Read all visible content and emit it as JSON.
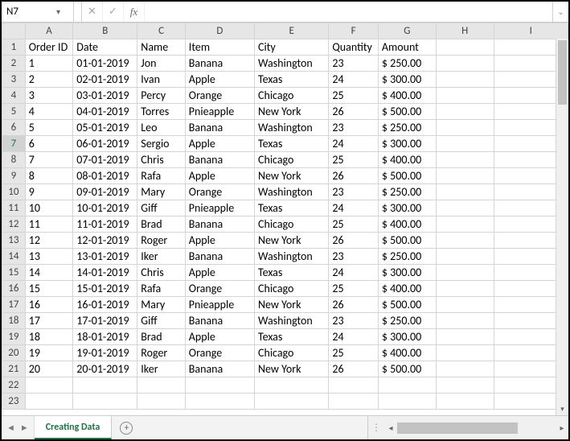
{
  "formula_bar": {
    "name_box": "N7",
    "cancel": "✕",
    "confirm": "✓",
    "fx": "fx",
    "formula": "",
    "expand": "⌄"
  },
  "columns": [
    "A",
    "B",
    "C",
    "D",
    "E",
    "F",
    "G",
    "H",
    "I"
  ],
  "headers": [
    "Order ID",
    "Date",
    "Name",
    "Item",
    "City",
    "Quantity",
    "Amount"
  ],
  "rows": [
    {
      "n": 1,
      "id": "1",
      "date": "01-01-2019",
      "name": "Jon",
      "item": "Banana",
      "city": "Washington",
      "qty": "23",
      "amt": "$ 250.00"
    },
    {
      "n": 2,
      "id": "2",
      "date": "02-01-2019",
      "name": "Ivan",
      "item": "Apple",
      "city": "Texas",
      "qty": "24",
      "amt": "$ 300.00"
    },
    {
      "n": 3,
      "id": "3",
      "date": "03-01-2019",
      "name": "Percy",
      "item": "Orange",
      "city": "Chicago",
      "qty": "25",
      "amt": "$ 400.00"
    },
    {
      "n": 4,
      "id": "4",
      "date": "04-01-2019",
      "name": "Torres",
      "item": "Pnieapple",
      "city": "New York",
      "qty": "26",
      "amt": "$ 500.00"
    },
    {
      "n": 5,
      "id": "5",
      "date": "05-01-2019",
      "name": "Leo",
      "item": "Banana",
      "city": "Washington",
      "qty": "23",
      "amt": "$ 250.00"
    },
    {
      "n": 6,
      "id": "6",
      "date": "06-01-2019",
      "name": "Sergio",
      "item": "Apple",
      "city": "Texas",
      "qty": "24",
      "amt": "$ 300.00"
    },
    {
      "n": 7,
      "id": "7",
      "date": "07-01-2019",
      "name": "Chris",
      "item": "Banana",
      "city": "Chicago",
      "qty": "25",
      "amt": "$ 400.00"
    },
    {
      "n": 8,
      "id": "8",
      "date": "08-01-2019",
      "name": "Rafa",
      "item": "Apple",
      "city": "New York",
      "qty": "26",
      "amt": "$ 500.00"
    },
    {
      "n": 9,
      "id": "9",
      "date": "09-01-2019",
      "name": "Mary",
      "item": "Orange",
      "city": "Washington",
      "qty": "23",
      "amt": "$ 250.00"
    },
    {
      "n": 10,
      "id": "10",
      "date": "10-01-2019",
      "name": "Giff",
      "item": "Pnieapple",
      "city": "Texas",
      "qty": "24",
      "amt": "$ 300.00"
    },
    {
      "n": 11,
      "id": "11",
      "date": "11-01-2019",
      "name": "Brad",
      "item": "Banana",
      "city": "Chicago",
      "qty": "25",
      "amt": "$ 400.00"
    },
    {
      "n": 12,
      "id": "12",
      "date": "12-01-2019",
      "name": "Roger",
      "item": "Apple",
      "city": "New York",
      "qty": "26",
      "amt": "$ 500.00"
    },
    {
      "n": 13,
      "id": "13",
      "date": "13-01-2019",
      "name": "Iker",
      "item": "Banana",
      "city": "Washington",
      "qty": "23",
      "amt": "$ 250.00"
    },
    {
      "n": 14,
      "id": "14",
      "date": "14-01-2019",
      "name": "Chris",
      "item": "Apple",
      "city": "Texas",
      "qty": "24",
      "amt": "$ 300.00"
    },
    {
      "n": 15,
      "id": "15",
      "date": "15-01-2019",
      "name": "Rafa",
      "item": "Orange",
      "city": "Chicago",
      "qty": "25",
      "amt": "$ 400.00"
    },
    {
      "n": 16,
      "id": "16",
      "date": "16-01-2019",
      "name": "Mary",
      "item": "Pnieapple",
      "city": "New York",
      "qty": "26",
      "amt": "$ 500.00"
    },
    {
      "n": 17,
      "id": "17",
      "date": "17-01-2019",
      "name": "Giff",
      "item": "Banana",
      "city": "Washington",
      "qty": "23",
      "amt": "$ 250.00"
    },
    {
      "n": 18,
      "id": "18",
      "date": "18-01-2019",
      "name": "Brad",
      "item": "Apple",
      "city": "Texas",
      "qty": "24",
      "amt": "$ 300.00"
    },
    {
      "n": 19,
      "id": "19",
      "date": "19-01-2019",
      "name": "Roger",
      "item": "Orange",
      "city": "Chicago",
      "qty": "25",
      "amt": "$ 400.00"
    },
    {
      "n": 20,
      "id": "20",
      "date": "20-01-2019",
      "name": "Iker",
      "item": "Banana",
      "city": "New York",
      "qty": "26",
      "amt": "$ 500.00"
    }
  ],
  "extra_rows": [
    22,
    23
  ],
  "selected_row": 7,
  "sheet_tabs": {
    "active": "Creating Data"
  }
}
